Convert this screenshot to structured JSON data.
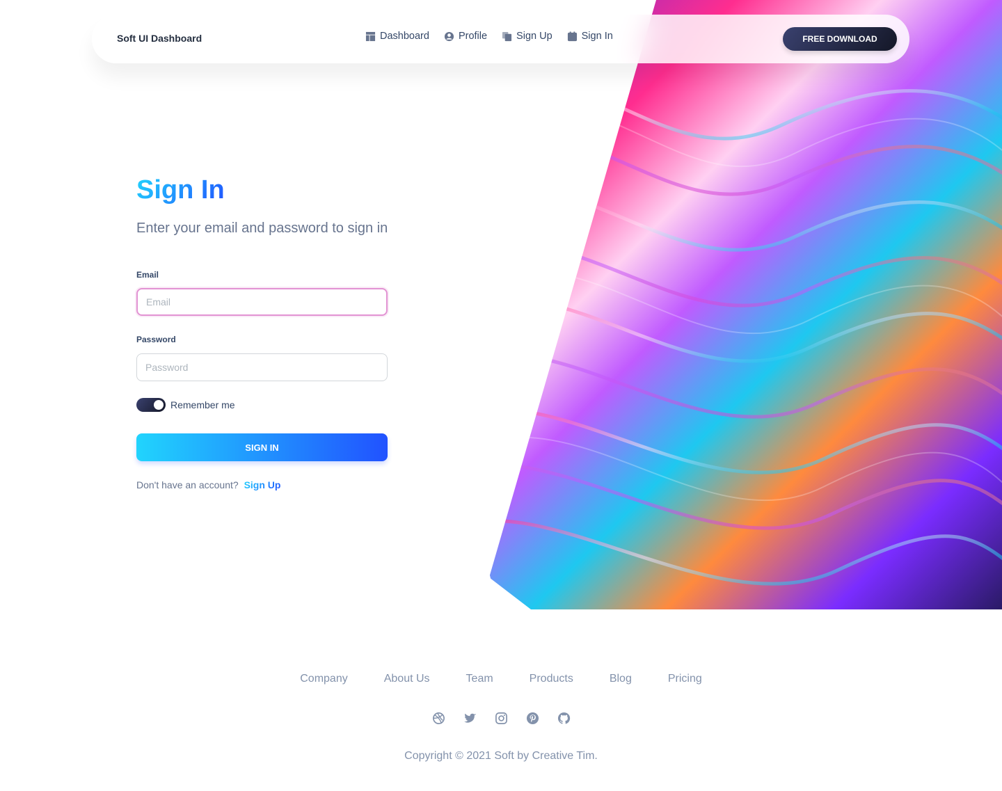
{
  "navbar": {
    "brand": "Soft UI Dashboard",
    "links": [
      {
        "label": "Dashboard",
        "icon": "dashboard-icon"
      },
      {
        "label": "Profile",
        "icon": "user-circle-icon"
      },
      {
        "label": "Sign Up",
        "icon": "copy-icon"
      },
      {
        "label": "Sign In",
        "icon": "calendar-icon"
      }
    ],
    "cta_label": "FREE DOWNLOAD"
  },
  "form": {
    "title": "Sign In",
    "subtitle": "Enter your email and password to sign in",
    "email_label": "Email",
    "email_placeholder": "Email",
    "password_label": "Password",
    "password_placeholder": "Password",
    "remember_label": "Remember me",
    "remember_on": true,
    "submit_label": "SIGN IN",
    "signup_prompt": "Don't have an account?",
    "signup_link": "Sign Up"
  },
  "footer": {
    "links": [
      "Company",
      "About Us",
      "Team",
      "Products",
      "Blog",
      "Pricing"
    ],
    "socials": [
      "dribbble-icon",
      "twitter-icon",
      "instagram-icon",
      "pinterest-icon",
      "github-icon"
    ],
    "copyright": "Copyright © 2021 Soft by Creative Tim."
  },
  "colors": {
    "accent_start": "#21d4fd",
    "accent_end": "#2152ff",
    "dark_start": "#141727",
    "dark_end": "#3a416f",
    "muted_text": "#8392ab"
  }
}
